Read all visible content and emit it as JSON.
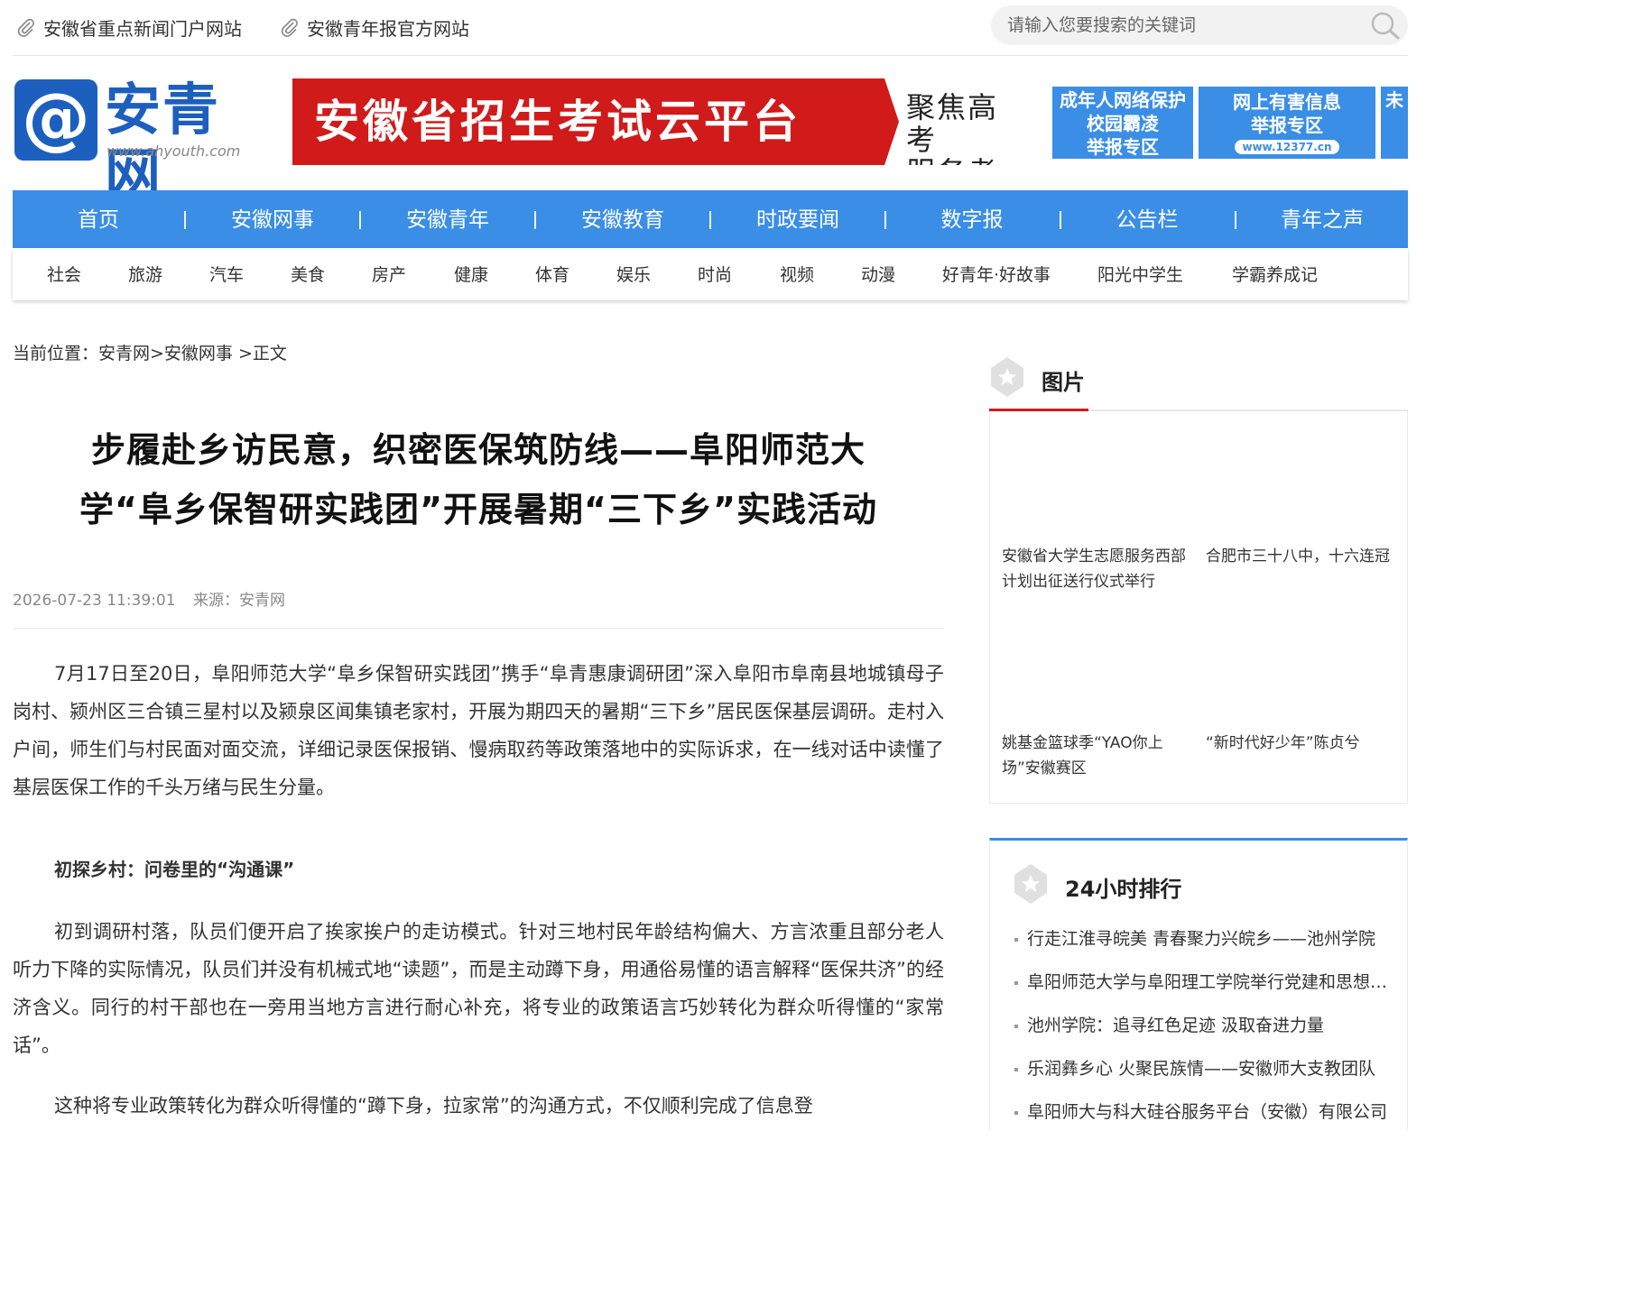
{
  "topbar": {
    "link1": "安徽省重点新闻门户网站",
    "link2": "安徽青年报官方网站",
    "search_placeholder": "请输入您要搜索的关键词"
  },
  "header": {
    "logo_text": "安青网",
    "logo_url": "www.ahyouth.com",
    "banner_title": "安徽省招生考试云平台",
    "banner_side_1": "聚焦高考",
    "banner_side_2": "服务考生",
    "ad1_lines": [
      "成年人网络保护",
      "校园霸凌",
      "举报专区"
    ],
    "ad2_lines": [
      "网上有害信息",
      "举报专区"
    ],
    "ad2_url": "www.12377.cn",
    "ad3_text": "未"
  },
  "nav": {
    "items": [
      "首页",
      "安徽网事",
      "安徽青年",
      "安徽教育",
      "时政要闻",
      "数字报",
      "公告栏",
      "青年之声"
    ]
  },
  "subnav": {
    "items": [
      "社会",
      "旅游",
      "汽车",
      "美食",
      "房产",
      "健康",
      "体育",
      "娱乐",
      "时尚",
      "视频",
      "动漫",
      "好青年·好故事",
      "阳光中学生",
      "学霸养成记"
    ]
  },
  "breadcrumb": "当前位置：安青网>安徽网事 >正文",
  "article": {
    "title_line1": "步履赴乡访民意，织密医保筑防线——阜阳师范大",
    "title_line2": "学“阜乡保智研实践团”开展暑期“三下乡”实践活动",
    "date": "2026-07-23 11:39:01",
    "source": "来源：安青网",
    "p1": "7月17日至20日，阜阳师范大学“阜乡保智研实践团”携手“阜青惠康调研团”深入阜阳市阜南县地城镇母子岗村、颍州区三合镇三星村以及颍泉区闻集镇老家村，开展为期四天的暑期“三下乡”居民医保基层调研。走村入户间，师生们与村民面对面交流，详细记录医保报销、慢病取药等政策落地中的实际诉求，在一线对话中读懂了基层医保工作的千头万绪与民生分量。",
    "subhead": "初探乡村：问卷里的“沟通课”",
    "p2": "初到调研村落，队员们便开启了挨家挨户的走访模式。针对三地村民年龄结构偏大、方言浓重且部分老人听力下降的实际情况，队员们并没有机械式地“读题”，而是主动蹲下身，用通俗易懂的语言解释“医保共济”的经济含义。同行的村干部也在一旁用当地方言进行耐心补充，将专业的政策语言巧妙转化为群众听得懂的“家常话”。",
    "p3": "这种将专业政策转化为群众听得懂的“蹲下身，拉家常”的沟通方式，不仅顺利完成了信息登"
  },
  "sidebar": {
    "photo_title": "图片",
    "photos": [
      "安徽省大学生志愿服务西部计划出征送行仪式举行",
      "合肥市三十八中，十六连冠",
      "姚基金篮球季“YAO你上场”安徽赛区",
      "“新时代好少年”陈贞兮"
    ],
    "rank_title": "24小时排行",
    "rank_items": [
      "行走江淮寻皖美 青春聚力兴皖乡——池州学院",
      "阜阳师范大学与阜阳理工学院举行党建和思想政治",
      "池州学院：追寻红色足迹 汲取奋进力量",
      "乐润彝乡心 火聚民族情——安徽师大支教团队",
      "阜阳师大与科大硅谷服务平台（安徽）有限公司"
    ]
  },
  "colors": {
    "accent_blue": "#3a8ee6",
    "banner_red": "#d11a1a",
    "logo_blue": "#1d5fbe"
  }
}
